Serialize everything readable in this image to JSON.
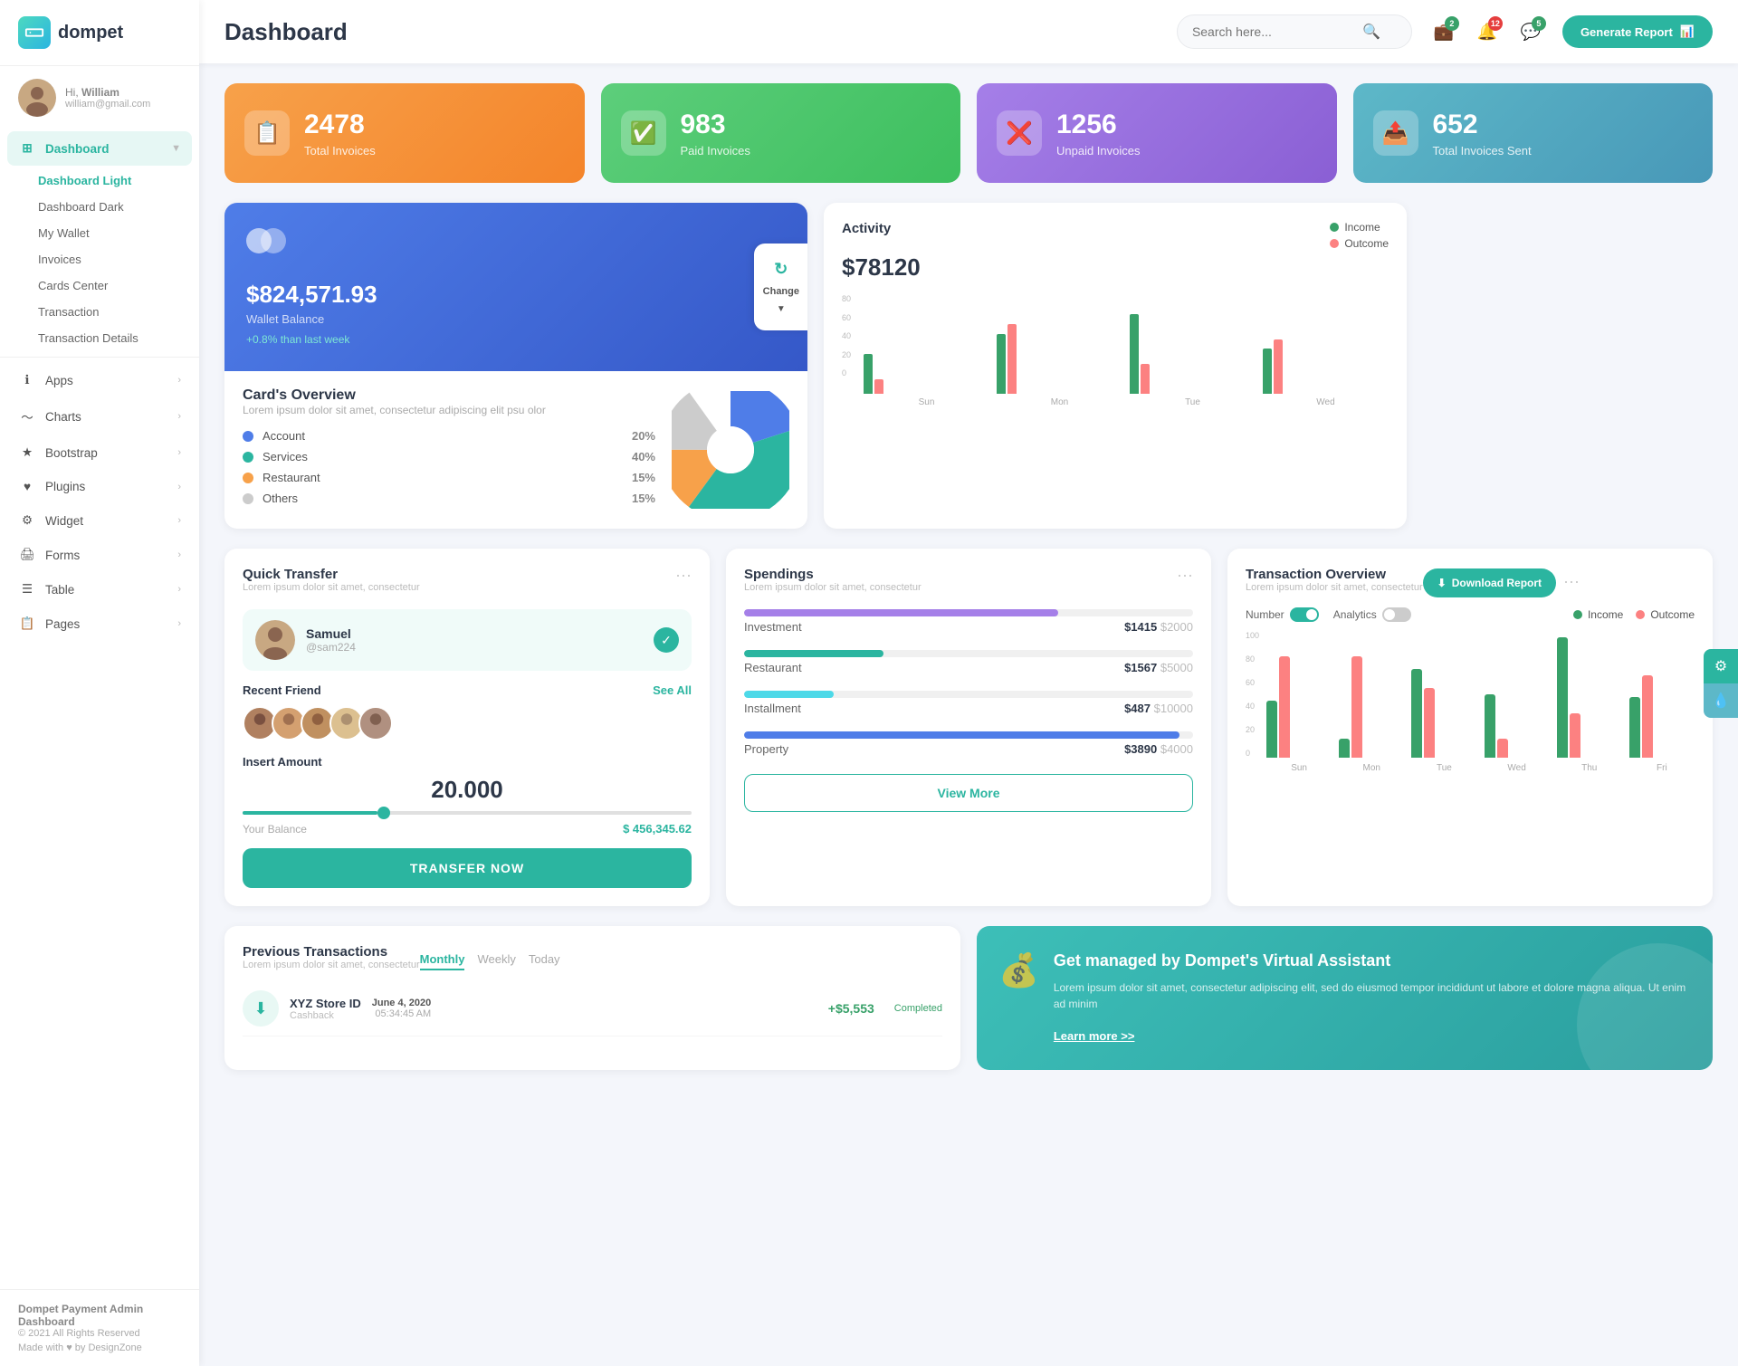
{
  "sidebar": {
    "logo_text": "dompet",
    "user": {
      "greeting": "Hi,",
      "name": "William",
      "email": "william@gmail.com"
    },
    "nav": {
      "dashboard_label": "Dashboard",
      "dashboard_arrow": "▼",
      "sub_items": [
        {
          "label": "Dashboard Light",
          "active": true
        },
        {
          "label": "Dashboard Dark"
        },
        {
          "label": "My Wallet"
        },
        {
          "label": "Invoices"
        },
        {
          "label": "Cards Center"
        },
        {
          "label": "Transaction"
        },
        {
          "label": "Transaction Details"
        }
      ],
      "main_items": [
        {
          "label": "Apps",
          "icon": "ℹ"
        },
        {
          "label": "Charts",
          "icon": "📊"
        },
        {
          "label": "Bootstrap",
          "icon": "⭐"
        },
        {
          "label": "Plugins",
          "icon": "♥"
        },
        {
          "label": "Widget",
          "icon": "⚙"
        },
        {
          "label": "Forms",
          "icon": "🖨"
        },
        {
          "label": "Table",
          "icon": "☰"
        },
        {
          "label": "Pages",
          "icon": "📋"
        }
      ]
    },
    "footer": {
      "brand": "Dompet Payment Admin Dashboard",
      "copy": "© 2021 All Rights Reserved",
      "made": "Made with ♥ by DesignZone"
    }
  },
  "topbar": {
    "title": "Dashboard",
    "search_placeholder": "Search here...",
    "icons": [
      {
        "name": "wallet-icon",
        "badge": "2",
        "badge_color": "green"
      },
      {
        "name": "bell-icon",
        "badge": "12",
        "badge_color": "red"
      },
      {
        "name": "chat-icon",
        "badge": "5",
        "badge_color": "green"
      }
    ],
    "generate_btn": "Generate Report"
  },
  "stats": [
    {
      "num": "2478",
      "label": "Total Invoices",
      "color": "orange",
      "icon": "📋"
    },
    {
      "num": "983",
      "label": "Paid Invoices",
      "color": "green",
      "icon": "✅"
    },
    {
      "num": "1256",
      "label": "Unpaid Invoices",
      "color": "purple",
      "icon": "❌"
    },
    {
      "num": "652",
      "label": "Total Invoices Sent",
      "color": "teal",
      "icon": "📤"
    }
  ],
  "card_overview": {
    "wallet_amount": "$824,571.93",
    "wallet_label": "Wallet Balance",
    "wallet_change": "+0.8% than last week",
    "change_btn": "Change",
    "title": "Card's Overview",
    "sub": "Lorem ipsum dolor sit amet, consectetur adipiscing elit psu olor",
    "categories": [
      {
        "label": "Account",
        "pct": "20%",
        "color": "#4f7de8"
      },
      {
        "label": "Services",
        "pct": "40%",
        "color": "#2bb5a0"
      },
      {
        "label": "Restaurant",
        "pct": "15%",
        "color": "#f7a14a"
      },
      {
        "label": "Others",
        "pct": "15%",
        "color": "#ccc"
      }
    ]
  },
  "activity": {
    "title": "Activity",
    "amount": "$78120",
    "legend": [
      {
        "label": "Income",
        "color": "#38a169"
      },
      {
        "label": "Outcome",
        "color": "#fc8181"
      }
    ],
    "bars": [
      {
        "label": "Sun",
        "income": 40,
        "outcome": 15
      },
      {
        "label": "Mon",
        "income": 60,
        "outcome": 70
      },
      {
        "label": "Tue",
        "income": 80,
        "outcome": 30
      },
      {
        "label": "Wed",
        "income": 45,
        "outcome": 55
      }
    ]
  },
  "quick_transfer": {
    "title": "Quick Transfer",
    "sub": "Lorem ipsum dolor sit amet, consectetur",
    "selected": {
      "name": "Samuel",
      "handle": "@sam224"
    },
    "recent_label": "Recent Friend",
    "see_all": "See All",
    "insert_label": "Insert Amount",
    "amount": "20.000",
    "balance_label": "Your Balance",
    "balance": "$ 456,345.62",
    "transfer_btn": "TRANSFER NOW"
  },
  "spendings": {
    "title": "Spendings",
    "sub": "Lorem ipsum dolor sit amet, consectetur",
    "items": [
      {
        "name": "Investment",
        "current": "$1415",
        "total": "$2000",
        "pct": 70,
        "color": "#a57fe8"
      },
      {
        "name": "Restaurant",
        "current": "$1567",
        "total": "$5000",
        "pct": 31,
        "color": "#2bb5a0"
      },
      {
        "name": "Installment",
        "current": "$487",
        "total": "$10000",
        "pct": 20,
        "color": "#4dd9e8"
      },
      {
        "name": "Property",
        "current": "$3890",
        "total": "$4000",
        "pct": 97,
        "color": "#4f7de8"
      }
    ],
    "view_more": "View More"
  },
  "transaction_overview": {
    "title": "Transaction Overview",
    "sub": "Lorem ipsum dolor sit amet, consectetur",
    "download_btn": "Download Report",
    "toggle1": "Number",
    "toggle2": "Analytics",
    "legend": [
      {
        "label": "Income",
        "color": "#38a169"
      },
      {
        "label": "Outcome",
        "color": "#fc8181"
      }
    ],
    "bars": [
      {
        "label": "Sun",
        "income": 45,
        "outcome": 80
      },
      {
        "label": "Mon",
        "income": 15,
        "outcome": 80
      },
      {
        "label": "Tue",
        "income": 70,
        "outcome": 55
      },
      {
        "label": "Wed",
        "income": 50,
        "outcome": 15
      },
      {
        "label": "Thu",
        "income": 95,
        "outcome": 35
      },
      {
        "label": "Fri",
        "income": 48,
        "outcome": 65
      }
    ],
    "y_labels": [
      "100",
      "80",
      "60",
      "40",
      "20",
      "0"
    ]
  },
  "prev_transactions": {
    "title": "Previous Transactions",
    "sub": "Lorem ipsum dolor sit amet, consectetur",
    "tabs": [
      "Monthly",
      "Weekly",
      "Today"
    ],
    "active_tab": "Monthly",
    "items": [
      {
        "name": "XYZ Store ID",
        "type": "Cashback",
        "date": "June 4, 2020",
        "time": "05:34:45 AM",
        "amount": "+$5,553",
        "status": "Completed"
      }
    ]
  },
  "va_widget": {
    "title": "Get managed by Dompet's Virtual Assistant",
    "sub": "Lorem ipsum dolor sit amet, consectetur adipiscing elit, sed do eiusmod tempor incididunt ut labore et dolore magna aliqua. Ut enim ad minim",
    "link": "Learn more >>"
  }
}
